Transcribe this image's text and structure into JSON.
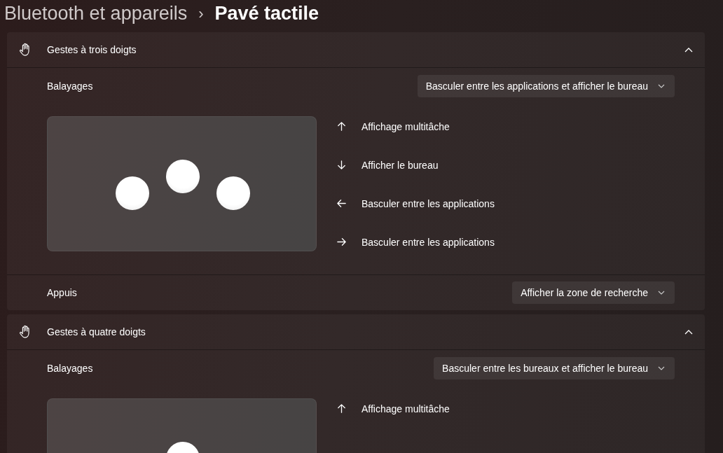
{
  "breadcrumb": {
    "parent": "Bluetooth et appareils",
    "separator": "›",
    "current": "Pavé tactile"
  },
  "sections": [
    {
      "title": "Gestes à trois doigts",
      "expanded": true,
      "swipes": {
        "label": "Balayages",
        "value": "Basculer entre les applications et afficher le bureau"
      },
      "actions": [
        {
          "kind": "up",
          "label": "Affichage multitâche"
        },
        {
          "kind": "down",
          "label": "Afficher le bureau"
        },
        {
          "kind": "left",
          "label": "Basculer entre les applications"
        },
        {
          "kind": "right",
          "label": "Basculer entre les applications"
        }
      ],
      "tap": {
        "label": "Appuis",
        "value": "Afficher la zone de recherche"
      }
    },
    {
      "title": "Gestes à quatre doigts",
      "expanded": true,
      "swipes": {
        "label": "Balayages",
        "value": "Basculer entre les bureaux et afficher le bureau"
      },
      "actions": [
        {
          "kind": "up",
          "label": "Affichage multitâche"
        }
      ]
    }
  ]
}
